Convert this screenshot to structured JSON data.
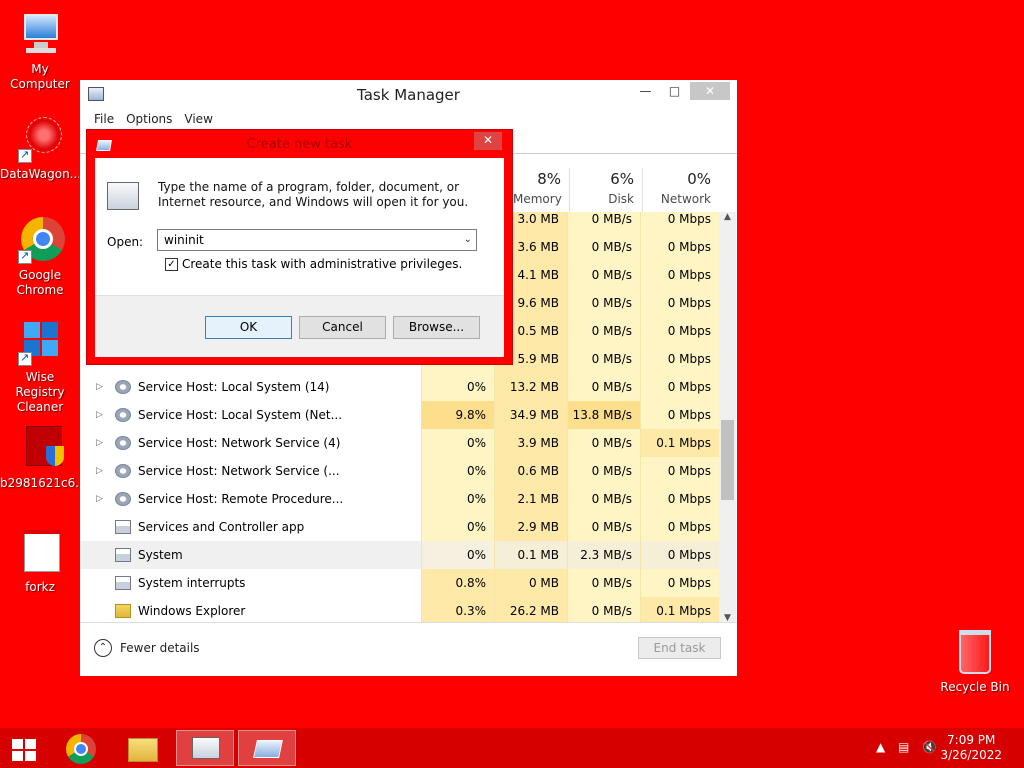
{
  "desktop": {
    "icons": [
      {
        "label": "My Computer"
      },
      {
        "label": "DataWagon..."
      },
      {
        "label": "Google\nChrome"
      },
      {
        "label": "Wise Registry\nCleaner"
      },
      {
        "label": "b2981621c6..."
      },
      {
        "label": "forkz"
      }
    ],
    "recycle_bin": "Recycle Bin"
  },
  "task_manager": {
    "title": "Task Manager",
    "minimize": "—",
    "maximize": "□",
    "close": "✕",
    "menu": [
      "File",
      "Options",
      "View"
    ],
    "columns": [
      {
        "pct": "8%",
        "label": "Memory"
      },
      {
        "pct": "6%",
        "label": "Disk"
      },
      {
        "pct": "0%",
        "label": "Network"
      }
    ],
    "rows": [
      {
        "name": "",
        "cpu": "",
        "mem": "3.0 MB",
        "disk": "0 MB/s",
        "net": "0 Mbps",
        "icon": "none"
      },
      {
        "name": "",
        "cpu": "",
        "mem": "3.6 MB",
        "disk": "0 MB/s",
        "net": "0 Mbps",
        "icon": "none"
      },
      {
        "name": "",
        "cpu": "",
        "mem": "4.1 MB",
        "disk": "0 MB/s",
        "net": "0 Mbps",
        "icon": "none"
      },
      {
        "name": "",
        "cpu": "",
        "mem": "9.6 MB",
        "disk": "0 MB/s",
        "net": "0 Mbps",
        "icon": "none"
      },
      {
        "name": "",
        "cpu": "",
        "mem": "0.5 MB",
        "disk": "0 MB/s",
        "net": "0 Mbps",
        "icon": "none"
      },
      {
        "name": "",
        "cpu": "",
        "mem": "5.9 MB",
        "disk": "0 MB/s",
        "net": "0 Mbps",
        "icon": "none"
      },
      {
        "name": "Service Host: Local System (14)",
        "cpu": "0%",
        "mem": "13.2 MB",
        "disk": "0 MB/s",
        "net": "0 Mbps",
        "icon": "gear"
      },
      {
        "name": "Service Host: Local System (Net...",
        "cpu": "9.8%",
        "mem": "34.9 MB",
        "disk": "13.8 MB/s",
        "net": "0 Mbps",
        "icon": "gear"
      },
      {
        "name": "Service Host: Network Service (4)",
        "cpu": "0%",
        "mem": "3.9 MB",
        "disk": "0 MB/s",
        "net": "0.1 Mbps",
        "icon": "gear"
      },
      {
        "name": "Service Host: Network Service (...",
        "cpu": "0%",
        "mem": "0.6 MB",
        "disk": "0 MB/s",
        "net": "0 Mbps",
        "icon": "gear"
      },
      {
        "name": "Service Host: Remote Procedure...",
        "cpu": "0%",
        "mem": "2.1 MB",
        "disk": "0 MB/s",
        "net": "0 Mbps",
        "icon": "gear"
      },
      {
        "name": "Services and Controller app",
        "cpu": "0%",
        "mem": "2.9 MB",
        "disk": "0 MB/s",
        "net": "0 Mbps",
        "icon": "app"
      },
      {
        "name": "System",
        "cpu": "0%",
        "mem": "0.1 MB",
        "disk": "2.3 MB/s",
        "net": "0 Mbps",
        "icon": "app"
      },
      {
        "name": "System interrupts",
        "cpu": "0.8%",
        "mem": "0 MB",
        "disk": "0 MB/s",
        "net": "0 Mbps",
        "icon": "app"
      },
      {
        "name": "Windows Explorer",
        "cpu": "0.3%",
        "mem": "26.2 MB",
        "disk": "0 MB/s",
        "net": "0.1 Mbps",
        "icon": "folder"
      }
    ],
    "fewer_details": "Fewer details",
    "end_task": "End task"
  },
  "dialog": {
    "title": "Create new task",
    "close": "✕",
    "description": "Type the name of a program, folder, document, or Internet resource, and Windows will open it for you.",
    "open_label": "Open:",
    "open_value": "wininit",
    "admin_checkbox_label": "Create this task with administrative privileges.",
    "admin_checked": true,
    "ok": "OK",
    "cancel": "Cancel",
    "browse": "Browse..."
  },
  "taskbar": {
    "time": "7:09 PM",
    "date": "3/26/2022"
  },
  "colors": {
    "desktop": "#ff0000",
    "taskbar": "#d60000",
    "heat_light": "#fff4c4",
    "heat_mid": "#ffe9a8"
  }
}
